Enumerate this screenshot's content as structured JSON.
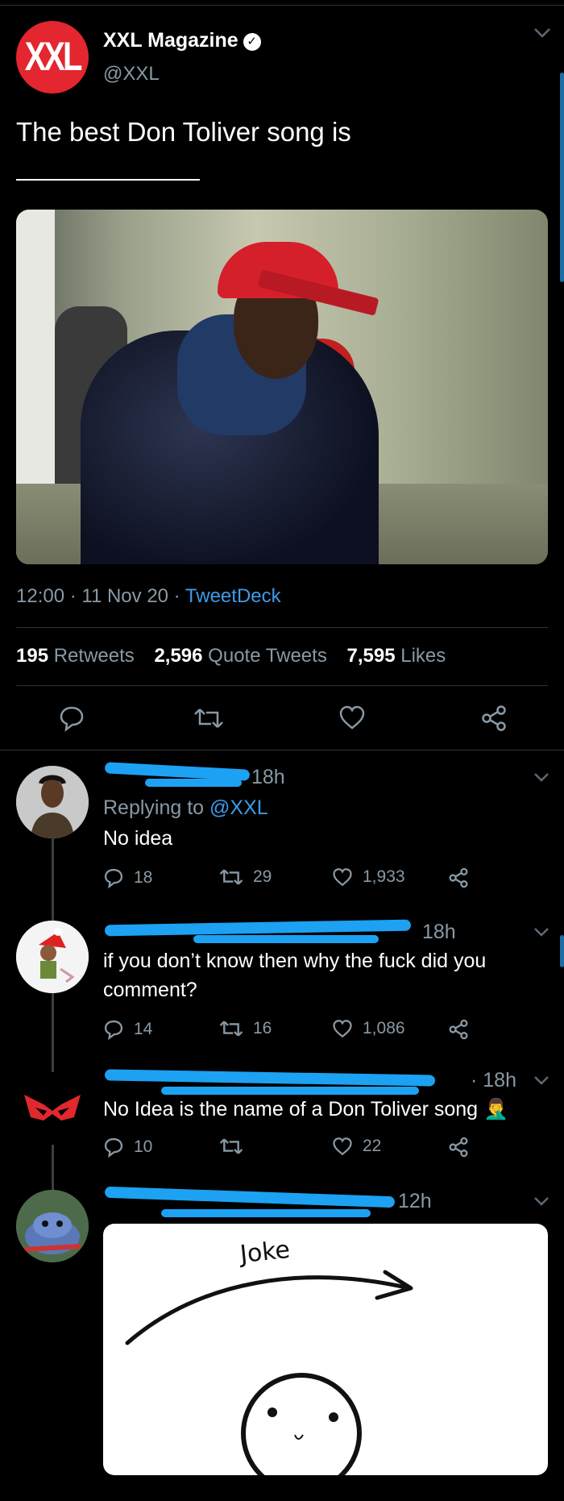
{
  "tweet": {
    "author_name": "XXL Magazine",
    "author_handle": "@XXL",
    "logo_text": "XXL",
    "verified_icon": "verified-check-icon",
    "text": "The best Don Toliver song is",
    "time": "12:00 · 11 Nov 20 · ",
    "source": "TweetDeck",
    "stats": {
      "retweets_count": "195",
      "retweets_label": "Retweets",
      "quotes_count": "2,596",
      "quotes_label": "Quote Tweets",
      "likes_count": "7,595",
      "likes_label": "Likes"
    }
  },
  "replies": [
    {
      "time": "18h",
      "replying_prefix": "Replying to ",
      "replying_to": "@XXL",
      "text": "No idea",
      "reply_count": "18",
      "retweet_count": "29",
      "like_count": "1,933"
    },
    {
      "time": "18h",
      "text_line1": "if you don’t know then why the fuck did you",
      "text_line2": "comment?",
      "reply_count": "14",
      "retweet_count": "16",
      "like_count": "1,086"
    },
    {
      "time": "· 18h",
      "text": "No Idea is the name of a Don Toliver song",
      "emoji": "🤦‍♂️",
      "reply_count": "10",
      "retweet_count": "",
      "like_count": "22"
    },
    {
      "time": "12h",
      "image_label": "Joke"
    }
  ],
  "colors": {
    "background": "#000000",
    "secondary_text": "#8899a6",
    "link": "#3d9be9",
    "divider": "#2f3336",
    "xxl_red": "#e3262f",
    "redaction": "#1da1f2"
  }
}
